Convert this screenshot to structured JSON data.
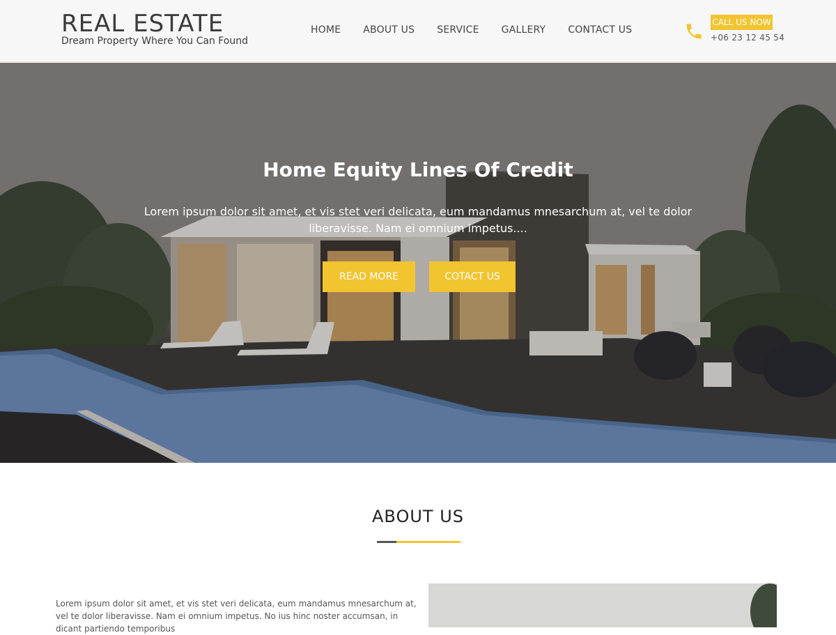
{
  "logo": {
    "title": "REAL ESTATE",
    "tagline": "Dream Property Where You Can Found"
  },
  "nav": {
    "items": [
      {
        "label": "HOME"
      },
      {
        "label": "ABOUT US"
      },
      {
        "label": "SERVICE"
      },
      {
        "label": "GALLERY"
      },
      {
        "label": "CONTACT US"
      }
    ]
  },
  "contact": {
    "call_label": "CALL US NOW",
    "phone": "+06 23 12 45 54",
    "icon": "phone-icon"
  },
  "hero": {
    "title": "Home Equity Lines Of Credit",
    "text": "Lorem ipsum dolor sit amet, et vis stet veri delicata, eum mandamus mnesarchum at, vel te dolor liberavisse. Nam ei omnium impetus....",
    "read_more": "READ MORE",
    "contact": "COTACT US"
  },
  "about": {
    "title": "ABOUT US",
    "text": "Lorem ipsum dolor sit amet, et vis stet veri delicata, eum mandamus mnesarchum at, vel te dolor liberavisse. Nam ei omnium impetus. No ius hinc noster accumsan, in dicant partiendo temporibus"
  },
  "colors": {
    "accent": "#f2c430",
    "text_dark": "#3b3b3b",
    "header_bg": "#f7f7f7"
  }
}
